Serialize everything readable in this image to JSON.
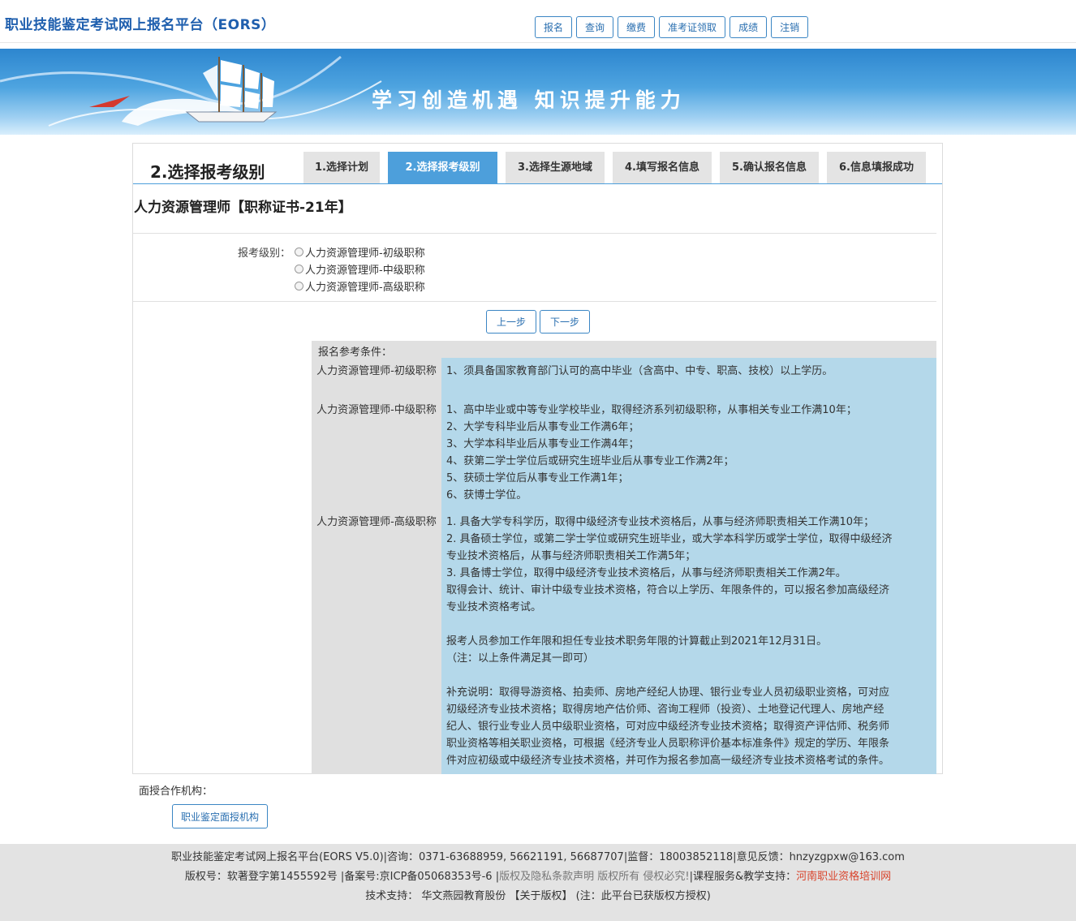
{
  "header": {
    "site_title": "职业技能鉴定考试网上报名平台（EORS）",
    "nav": [
      "报名",
      "查询",
      "缴费",
      "准考证领取",
      "成绩",
      "注销"
    ]
  },
  "banner": {
    "slogan": "学习创造机遇  知识提升能力"
  },
  "steps": {
    "current_title": "2.选择报考级别",
    "tabs": [
      {
        "label": "1.选择计划",
        "active": false
      },
      {
        "label": "2.选择报考级别",
        "active": true
      },
      {
        "label": "3.选择生源地域",
        "active": false
      },
      {
        "label": "4.填写报名信息",
        "active": false
      },
      {
        "label": "5.确认报名信息",
        "active": false
      },
      {
        "label": "6.信息填报成功",
        "active": false
      }
    ]
  },
  "certificate_title": "人力资源管理师【职称证书-21年】",
  "level_select": {
    "label": "报考级别：",
    "options": [
      "人力资源管理师-初级职称",
      "人力资源管理师-中级职称",
      "人力资源管理师-高级职称"
    ]
  },
  "pager": {
    "prev": "上一步",
    "next": "下一步"
  },
  "requirements": {
    "heading": "报名参考条件：",
    "rows": [
      {
        "name": "人力资源管理师-初级职称",
        "lines": [
          "1、须具备国家教育部门认可的高中毕业（含高中、中专、职高、技校）以上学历。"
        ]
      },
      {
        "name": "人力资源管理师-中级职称",
        "lines": [
          "1、高中毕业或中等专业学校毕业，取得经济系列初级职称，从事相关专业工作满10年；",
          "2、大学专科毕业后从事专业工作满6年；",
          "3、大学本科毕业后从事专业工作满4年；",
          "4、获第二学士学位后或研究生班毕业后从事专业工作满2年；",
          "5、获硕士学位后从事专业工作满1年；",
          "6、获博士学位。"
        ]
      },
      {
        "name": "人力资源管理师-高级职称",
        "lines": [
          "1. 具备大学专科学历，取得中级经济专业技术资格后，从事与经济师职责相关工作满10年；",
          "2. 具备硕士学位，或第二学士学位或研究生班毕业，或大学本科学历或学士学位，取得中级经济",
          "专业技术资格后，从事与经济师职责相关工作满5年；",
          "3. 具备博士学位，取得中级经济专业技术资格后，从事与经济师职责相关工作满2年。",
          "取得会计、统计、审计中级专业技术资格，符合以上学历、年限条件的，可以报名参加高级经济",
          "专业技术资格考试。",
          "",
          "报考人员参加工作年限和担任专业技术职务年限的计算截止到2021年12月31日。",
          "（注：以上条件满足其一即可）",
          "",
          "补充说明：取得导游资格、拍卖师、房地产经纪人协理、银行业专业人员初级职业资格，可对应",
          "初级经济专业技术资格；取得房地产估价师、咨询工程师（投资）、土地登记代理人、房地产经",
          "纪人、银行业专业人员中级职业资格，可对应中级经济专业技术资格；取得资产评估师、税务师",
          "职业资格等相关职业资格，可根据《经济专业人员职称评价基本标准条件》规定的学历、年限条",
          "件对应初级或中级经济专业技术资格，并可作为报名参加高一级经济专业技术资格考试的条件。"
        ]
      }
    ]
  },
  "partners": {
    "label": "面授合作机构：",
    "button": "职业鉴定面授机构"
  },
  "footer": {
    "line1": "职业技能鉴定考试网上报名平台(EORS V5.0)|咨询：0371-63688959, 56621191, 56687707|监督：18003852118|意见反馈：hnzyzgpxw@163.com",
    "line2_a": "版权号：软著登字第1455592号 |备案号:京ICP备05068353号-6 |",
    "line2_b": "版权及隐私条款声明 版权所有 侵权必究!",
    "line2_c": "|课程服务&教学支持：",
    "line2_d": "河南职业资格培训网",
    "line3": "技术支持： 华文燕园教育股份 【关于版权】 (注：此平台已获版权方授权)"
  }
}
